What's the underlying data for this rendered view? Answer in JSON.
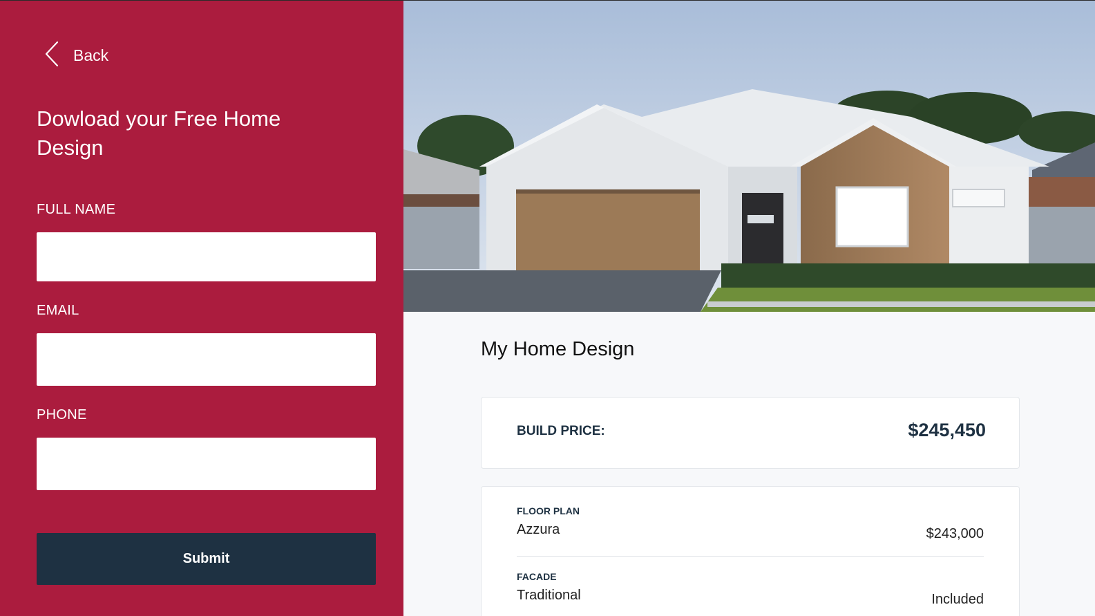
{
  "nav": {
    "back_label": "Back",
    "back_icon": "chevron-left-icon"
  },
  "form": {
    "title": "Dowload your Free Home Design",
    "full_name_label": "FULL NAME",
    "full_name_value": "",
    "email_label": "EMAIL",
    "email_value": "",
    "phone_label": "PHONE",
    "phone_value": "",
    "submit_label": "Submit"
  },
  "design": {
    "title": "My Home Design",
    "build_price_label": "BUILD PRICE:",
    "build_price_value": "$245,450",
    "items": [
      {
        "label": "FLOOR PLAN",
        "name": "Azzura",
        "price": "$243,000"
      },
      {
        "label": "FACADE",
        "name": "Traditional",
        "price": "Included"
      }
    ]
  },
  "colors": {
    "brand_red": "#ab1c3e",
    "navy": "#1e3142",
    "panel_bg": "#f7f8fa"
  }
}
